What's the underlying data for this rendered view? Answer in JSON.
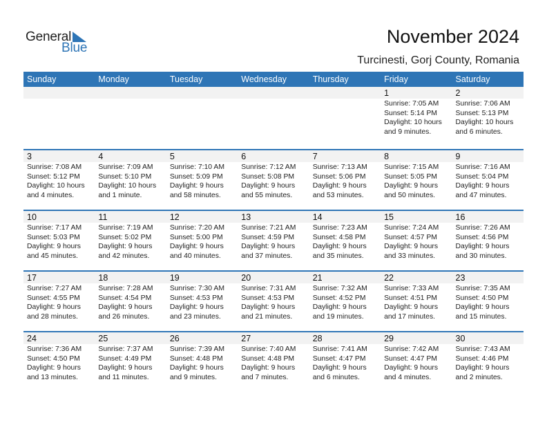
{
  "logo": {
    "line1": "General",
    "line2": "Blue",
    "icon": "triangle-flag-icon"
  },
  "title": "November 2024",
  "location": "Turcinesti, Gorj County, Romania",
  "colors": {
    "accent": "#2e75b6",
    "daynum_bg": "#f2f2f2"
  },
  "weekdays": [
    "Sunday",
    "Monday",
    "Tuesday",
    "Wednesday",
    "Thursday",
    "Friday",
    "Saturday"
  ],
  "weeks": [
    [
      null,
      null,
      null,
      null,
      null,
      {
        "day": "1",
        "sunrise": "Sunrise: 7:05 AM",
        "sunset": "Sunset: 5:14 PM",
        "daylight1": "Daylight: 10 hours",
        "daylight2": "and 9 minutes."
      },
      {
        "day": "2",
        "sunrise": "Sunrise: 7:06 AM",
        "sunset": "Sunset: 5:13 PM",
        "daylight1": "Daylight: 10 hours",
        "daylight2": "and 6 minutes."
      }
    ],
    [
      {
        "day": "3",
        "sunrise": "Sunrise: 7:08 AM",
        "sunset": "Sunset: 5:12 PM",
        "daylight1": "Daylight: 10 hours",
        "daylight2": "and 4 minutes."
      },
      {
        "day": "4",
        "sunrise": "Sunrise: 7:09 AM",
        "sunset": "Sunset: 5:10 PM",
        "daylight1": "Daylight: 10 hours",
        "daylight2": "and 1 minute."
      },
      {
        "day": "5",
        "sunrise": "Sunrise: 7:10 AM",
        "sunset": "Sunset: 5:09 PM",
        "daylight1": "Daylight: 9 hours",
        "daylight2": "and 58 minutes."
      },
      {
        "day": "6",
        "sunrise": "Sunrise: 7:12 AM",
        "sunset": "Sunset: 5:08 PM",
        "daylight1": "Daylight: 9 hours",
        "daylight2": "and 55 minutes."
      },
      {
        "day": "7",
        "sunrise": "Sunrise: 7:13 AM",
        "sunset": "Sunset: 5:06 PM",
        "daylight1": "Daylight: 9 hours",
        "daylight2": "and 53 minutes."
      },
      {
        "day": "8",
        "sunrise": "Sunrise: 7:15 AM",
        "sunset": "Sunset: 5:05 PM",
        "daylight1": "Daylight: 9 hours",
        "daylight2": "and 50 minutes."
      },
      {
        "day": "9",
        "sunrise": "Sunrise: 7:16 AM",
        "sunset": "Sunset: 5:04 PM",
        "daylight1": "Daylight: 9 hours",
        "daylight2": "and 47 minutes."
      }
    ],
    [
      {
        "day": "10",
        "sunrise": "Sunrise: 7:17 AM",
        "sunset": "Sunset: 5:03 PM",
        "daylight1": "Daylight: 9 hours",
        "daylight2": "and 45 minutes."
      },
      {
        "day": "11",
        "sunrise": "Sunrise: 7:19 AM",
        "sunset": "Sunset: 5:02 PM",
        "daylight1": "Daylight: 9 hours",
        "daylight2": "and 42 minutes."
      },
      {
        "day": "12",
        "sunrise": "Sunrise: 7:20 AM",
        "sunset": "Sunset: 5:00 PM",
        "daylight1": "Daylight: 9 hours",
        "daylight2": "and 40 minutes."
      },
      {
        "day": "13",
        "sunrise": "Sunrise: 7:21 AM",
        "sunset": "Sunset: 4:59 PM",
        "daylight1": "Daylight: 9 hours",
        "daylight2": "and 37 minutes."
      },
      {
        "day": "14",
        "sunrise": "Sunrise: 7:23 AM",
        "sunset": "Sunset: 4:58 PM",
        "daylight1": "Daylight: 9 hours",
        "daylight2": "and 35 minutes."
      },
      {
        "day": "15",
        "sunrise": "Sunrise: 7:24 AM",
        "sunset": "Sunset: 4:57 PM",
        "daylight1": "Daylight: 9 hours",
        "daylight2": "and 33 minutes."
      },
      {
        "day": "16",
        "sunrise": "Sunrise: 7:26 AM",
        "sunset": "Sunset: 4:56 PM",
        "daylight1": "Daylight: 9 hours",
        "daylight2": "and 30 minutes."
      }
    ],
    [
      {
        "day": "17",
        "sunrise": "Sunrise: 7:27 AM",
        "sunset": "Sunset: 4:55 PM",
        "daylight1": "Daylight: 9 hours",
        "daylight2": "and 28 minutes."
      },
      {
        "day": "18",
        "sunrise": "Sunrise: 7:28 AM",
        "sunset": "Sunset: 4:54 PM",
        "daylight1": "Daylight: 9 hours",
        "daylight2": "and 26 minutes."
      },
      {
        "day": "19",
        "sunrise": "Sunrise: 7:30 AM",
        "sunset": "Sunset: 4:53 PM",
        "daylight1": "Daylight: 9 hours",
        "daylight2": "and 23 minutes."
      },
      {
        "day": "20",
        "sunrise": "Sunrise: 7:31 AM",
        "sunset": "Sunset: 4:53 PM",
        "daylight1": "Daylight: 9 hours",
        "daylight2": "and 21 minutes."
      },
      {
        "day": "21",
        "sunrise": "Sunrise: 7:32 AM",
        "sunset": "Sunset: 4:52 PM",
        "daylight1": "Daylight: 9 hours",
        "daylight2": "and 19 minutes."
      },
      {
        "day": "22",
        "sunrise": "Sunrise: 7:33 AM",
        "sunset": "Sunset: 4:51 PM",
        "daylight1": "Daylight: 9 hours",
        "daylight2": "and 17 minutes."
      },
      {
        "day": "23",
        "sunrise": "Sunrise: 7:35 AM",
        "sunset": "Sunset: 4:50 PM",
        "daylight1": "Daylight: 9 hours",
        "daylight2": "and 15 minutes."
      }
    ],
    [
      {
        "day": "24",
        "sunrise": "Sunrise: 7:36 AM",
        "sunset": "Sunset: 4:50 PM",
        "daylight1": "Daylight: 9 hours",
        "daylight2": "and 13 minutes."
      },
      {
        "day": "25",
        "sunrise": "Sunrise: 7:37 AM",
        "sunset": "Sunset: 4:49 PM",
        "daylight1": "Daylight: 9 hours",
        "daylight2": "and 11 minutes."
      },
      {
        "day": "26",
        "sunrise": "Sunrise: 7:39 AM",
        "sunset": "Sunset: 4:48 PM",
        "daylight1": "Daylight: 9 hours",
        "daylight2": "and 9 minutes."
      },
      {
        "day": "27",
        "sunrise": "Sunrise: 7:40 AM",
        "sunset": "Sunset: 4:48 PM",
        "daylight1": "Daylight: 9 hours",
        "daylight2": "and 7 minutes."
      },
      {
        "day": "28",
        "sunrise": "Sunrise: 7:41 AM",
        "sunset": "Sunset: 4:47 PM",
        "daylight1": "Daylight: 9 hours",
        "daylight2": "and 6 minutes."
      },
      {
        "day": "29",
        "sunrise": "Sunrise: 7:42 AM",
        "sunset": "Sunset: 4:47 PM",
        "daylight1": "Daylight: 9 hours",
        "daylight2": "and 4 minutes."
      },
      {
        "day": "30",
        "sunrise": "Sunrise: 7:43 AM",
        "sunset": "Sunset: 4:46 PM",
        "daylight1": "Daylight: 9 hours",
        "daylight2": "and 2 minutes."
      }
    ]
  ]
}
